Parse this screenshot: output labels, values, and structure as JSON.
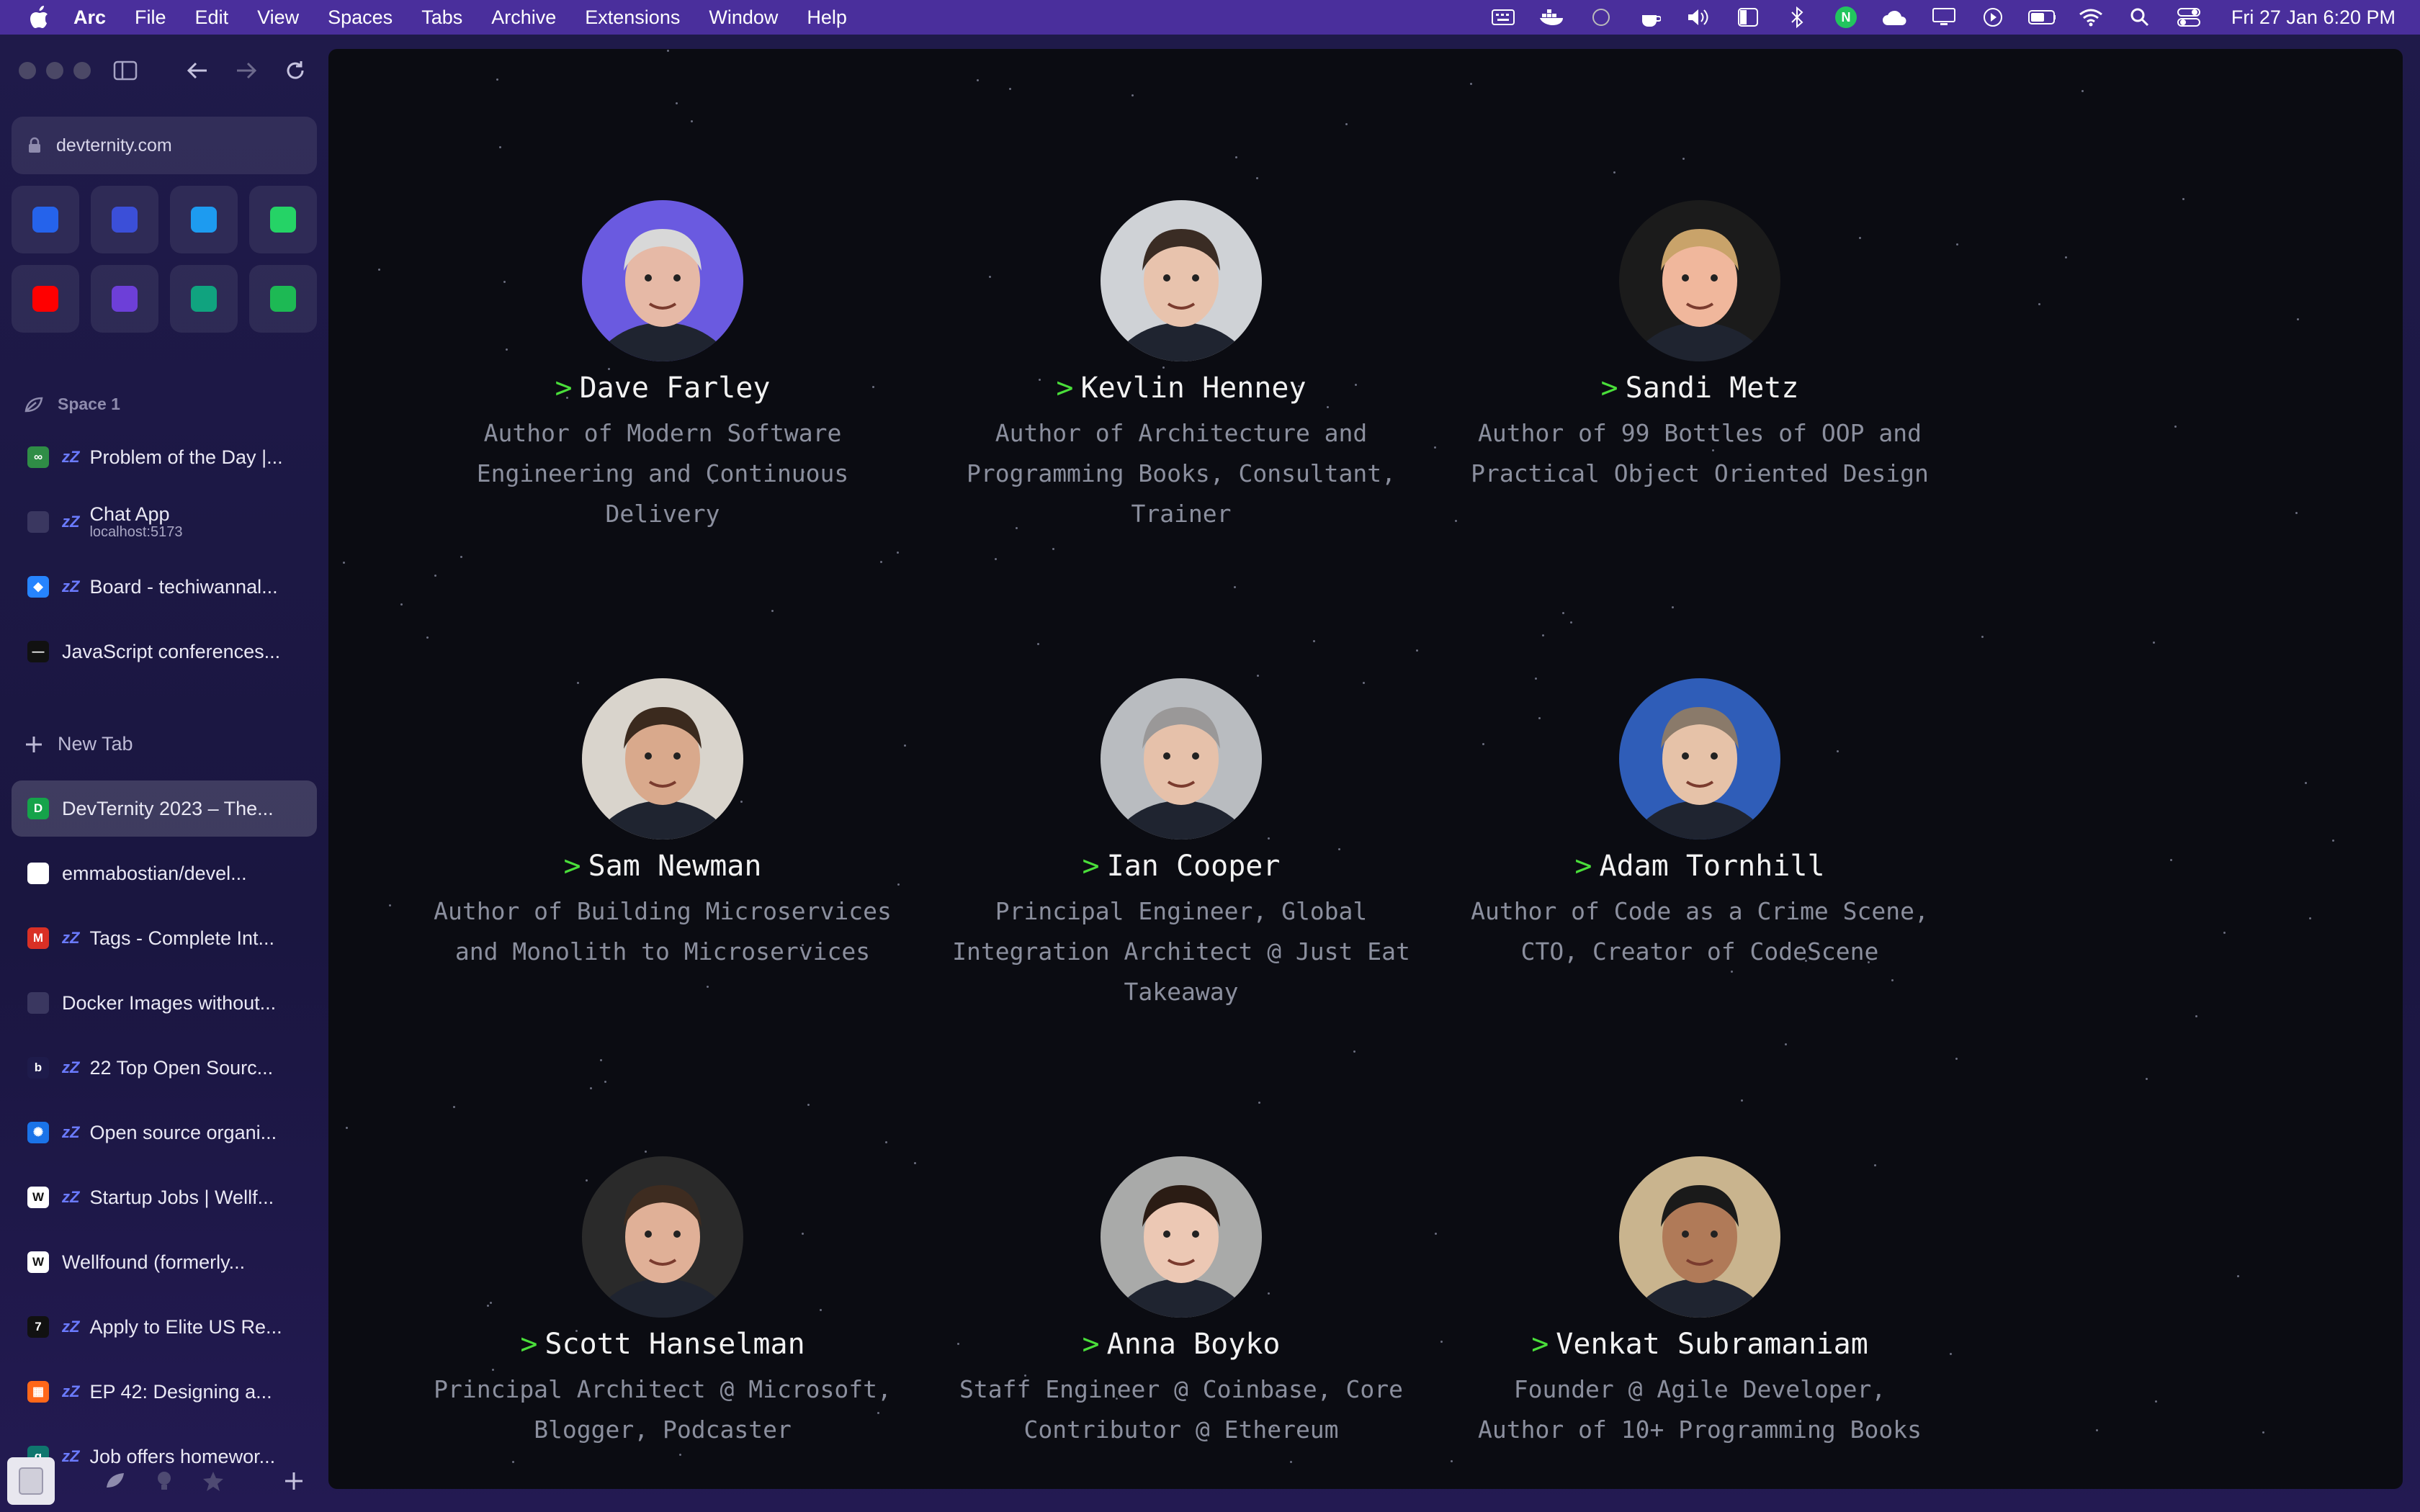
{
  "menubar": {
    "app_name": "Arc",
    "items": [
      "File",
      "Edit",
      "View",
      "Spaces",
      "Tabs",
      "Archive",
      "Extensions",
      "Window",
      "Help"
    ],
    "clock": "Fri 27 Jan  6:20 PM"
  },
  "browser": {
    "url": "devternity.com",
    "favorites": [
      {
        "icon": "devternity-icon",
        "color": "#2563eb"
      },
      {
        "icon": "planner-icon",
        "color": "#3b4fd8"
      },
      {
        "icon": "twitter-icon",
        "color": "#1d9bf0"
      },
      {
        "icon": "whatsapp-icon",
        "color": "#25d366"
      },
      {
        "icon": "youtube-icon",
        "color": "#ff0000"
      },
      {
        "icon": "bookmark-app-icon",
        "color": "#6d3fd8"
      },
      {
        "icon": "chatgpt-icon",
        "color": "#10a37f"
      },
      {
        "icon": "spotify-icon",
        "color": "#1db954"
      }
    ],
    "space_label": "Space 1",
    "pinned_tabs": [
      {
        "title": "Problem of the Day |...",
        "icon": "gfg-icon",
        "color": "#2f8d46",
        "glyph": "∞",
        "sleeping": true
      },
      {
        "title": "Chat App",
        "subtitle": "localhost:5173",
        "icon": "blank-page-icon",
        "color": "#3a3760",
        "glyph": "",
        "sleeping": true
      },
      {
        "title": "Board - techiwannal...",
        "icon": "jira-icon",
        "color": "#2684ff",
        "glyph": "◆",
        "sleeping": true
      },
      {
        "title": "JavaScript conferences...",
        "icon": "conf-icon",
        "color": "#111111",
        "glyph": "—",
        "sleeping": false
      }
    ],
    "new_tab_label": "New Tab",
    "tabs": [
      {
        "title": "DevTernity 2023 – The...",
        "icon": "devternity-tab-icon",
        "color": "#15a34a",
        "glyph": "D",
        "sleeping": false,
        "active": true
      },
      {
        "title": "emmabostian/devel...",
        "icon": "github-icon",
        "color": "#ffffff",
        "glyph": "",
        "sleeping": false
      },
      {
        "title": "Tags - Complete Int...",
        "icon": "gmail-icon",
        "color": "#d93025",
        "glyph": "M",
        "sleeping": true
      },
      {
        "title": "Docker Images without...",
        "icon": "blank-page-icon",
        "color": "#3a3760",
        "glyph": "",
        "sleeping": false
      },
      {
        "title": "22 Top Open Sourc...",
        "icon": "b-icon",
        "color": "#1e1b4b",
        "glyph": "b",
        "sleeping": true
      },
      {
        "title": "Open source organi...",
        "icon": "gsoc-icon",
        "color": "#1a73e8",
        "glyph": "✺",
        "sleeping": true
      },
      {
        "title": "Startup Jobs | Wellf...",
        "icon": "wellfound-icon",
        "color": "#ffffff",
        "glyph": "W",
        "sleeping": true
      },
      {
        "title": "Wellfound (formerly...",
        "icon": "wellfound-icon",
        "color": "#ffffff",
        "glyph": "W",
        "sleeping": false
      },
      {
        "title": "Apply to Elite US Re...",
        "icon": "turing-icon",
        "color": "#111111",
        "glyph": "7",
        "sleeping": true
      },
      {
        "title": "EP 42: Designing a...",
        "icon": "substack-icon",
        "color": "#ff6719",
        "glyph": "▦",
        "sleeping": true
      },
      {
        "title": "Job offers homewor...",
        "icon": "g-icon",
        "color": "#0f766e",
        "glyph": "g",
        "sleeping": true
      }
    ]
  },
  "speakers": [
    {
      "name": "Dave Farley",
      "role_lines": [
        "Author of Modern Software",
        "Engineering and Continuous",
        "Delivery"
      ],
      "avatar_bg": "#6a5ae0",
      "skin": "#e6b9a6",
      "hair": "#d8d8d8"
    },
    {
      "name": "Kevlin Henney",
      "role_lines": [
        "Author of Architecture and",
        "Programming Books, Consultant,",
        "Trainer"
      ],
      "avatar_bg": "#cfd2d6",
      "skin": "#e8c3ad",
      "hair": "#3a2c24"
    },
    {
      "name": "Sandi Metz",
      "role_lines": [
        "Author of 99 Bottles of OOP and",
        "Practical Object Oriented Design"
      ],
      "avatar_bg": "#1b1b1b",
      "skin": "#f0b79c",
      "hair": "#c9a36a"
    },
    {
      "name": "Sam Newman",
      "role_lines": [
        "Author of Building Microservices",
        "and Monolith to Microservices"
      ],
      "avatar_bg": "#d9d4cc",
      "skin": "#d9a98c",
      "hair": "#3b2a1e"
    },
    {
      "name": "Ian Cooper",
      "role_lines": [
        "Principal Engineer, Global",
        "Integration Architect @ Just Eat",
        "Takeaway"
      ],
      "avatar_bg": "#b9bcc0",
      "skin": "#e6c1aa",
      "hair": "#9a9898"
    },
    {
      "name": "Adam Tornhill",
      "role_lines": [
        "Author of Code as a Crime Scene,",
        "CTO, Creator of CodeScene"
      ],
      "avatar_bg": "#2f5db8",
      "skin": "#e6c2a8",
      "hair": "#8a7a6a"
    },
    {
      "name": "Scott Hanselman",
      "role_lines": [
        "Principal Architect @ Microsoft,",
        "Blogger, Podcaster"
      ],
      "avatar_bg": "#2a2a2a",
      "skin": "#e0b097",
      "hair": "#3e2c20"
    },
    {
      "name": "Anna Boyko",
      "role_lines": [
        "Staff Engineer @ Coinbase, Core",
        "Contributor @ Ethereum"
      ],
      "avatar_bg": "#a9aaa9",
      "skin": "#ecc8b4",
      "hair": "#2b1c14"
    },
    {
      "name": "Venkat Subramaniam",
      "role_lines": [
        "Founder @ Agile Developer,",
        "Author of 10+ Programming Books"
      ],
      "avatar_bg": "#c9b48e",
      "skin": "#b07a58",
      "hair": "#1a1a1a"
    }
  ]
}
